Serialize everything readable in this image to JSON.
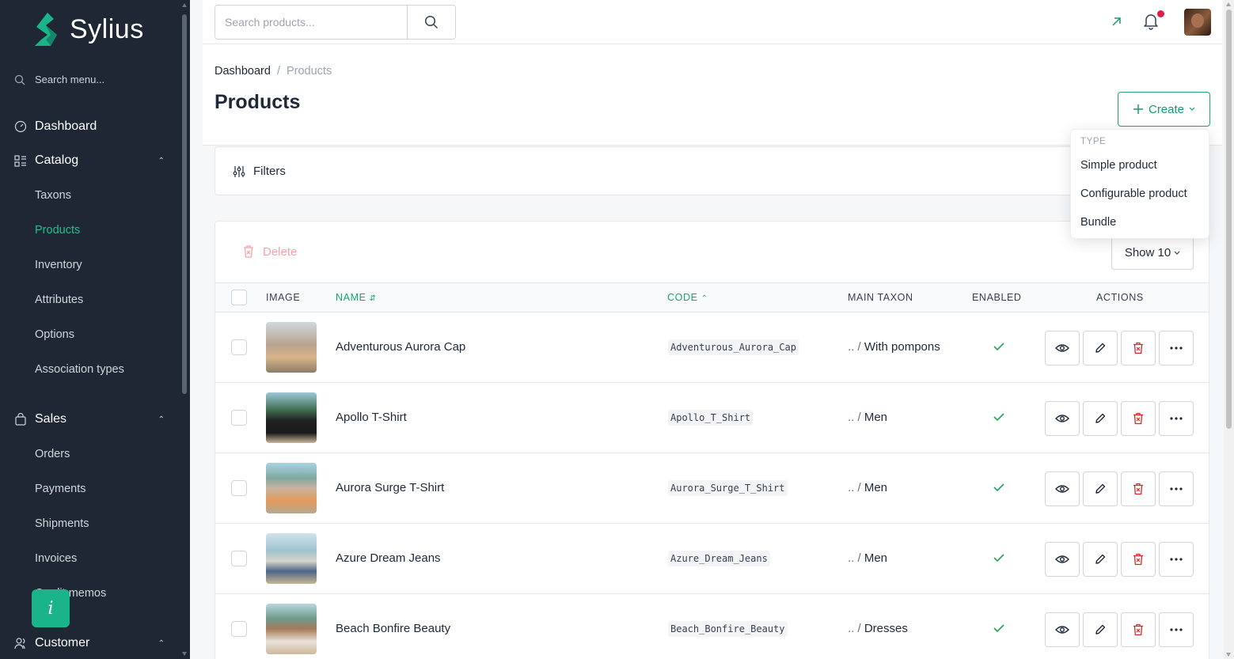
{
  "app": {
    "name": "Sylius"
  },
  "colors": {
    "brand": "#1bb38a",
    "sidebar_bg": "#1e2733",
    "danger": "#dc2626"
  },
  "sidebar": {
    "search_placeholder": "Search menu...",
    "dashboard": "Dashboard",
    "catalog": {
      "label": "Catalog",
      "items": [
        "Taxons",
        "Products",
        "Inventory",
        "Attributes",
        "Options",
        "Association types"
      ]
    },
    "sales": {
      "label": "Sales",
      "items": [
        "Orders",
        "Payments",
        "Shipments",
        "Invoices",
        "Credit memos"
      ]
    },
    "customer": {
      "label": "Customer"
    },
    "info_label": "i"
  },
  "topbar": {
    "search_placeholder": "Search products..."
  },
  "breadcrumb": {
    "home": "Dashboard",
    "separator": "/",
    "current": "Products"
  },
  "page": {
    "title": "Products",
    "create_label": "Create"
  },
  "create_menu": {
    "header": "TYPE",
    "options": [
      "Simple product",
      "Configurable product",
      "Bundle"
    ]
  },
  "filters": {
    "label": "Filters"
  },
  "grid": {
    "delete_label": "Delete",
    "show_label": "Show 10",
    "columns": {
      "image": "IMAGE",
      "name": "NAME",
      "code": "CODE",
      "main_taxon": "MAIN TAXON",
      "enabled": "ENABLED",
      "actions": "ACTIONS"
    },
    "rows": [
      {
        "name": "Adventurous Aurora Cap",
        "code": "Adventurous_Aurora_Cap",
        "taxon_prefix": ".. /",
        "taxon": "With pompons",
        "enabled": true
      },
      {
        "name": "Apollo T-Shirt",
        "code": "Apollo_T_Shirt",
        "taxon_prefix": ".. /",
        "taxon": "Men",
        "enabled": true
      },
      {
        "name": "Aurora Surge T-Shirt",
        "code": "Aurora_Surge_T_Shirt",
        "taxon_prefix": ".. /",
        "taxon": "Men",
        "enabled": true
      },
      {
        "name": "Azure Dream Jeans",
        "code": "Azure_Dream_Jeans",
        "taxon_prefix": ".. /",
        "taxon": "Men",
        "enabled": true
      },
      {
        "name": "Beach Bonfire Beauty",
        "code": "Beach_Bonfire_Beauty",
        "taxon_prefix": ".. /",
        "taxon": "Dresses",
        "enabled": true
      }
    ]
  }
}
